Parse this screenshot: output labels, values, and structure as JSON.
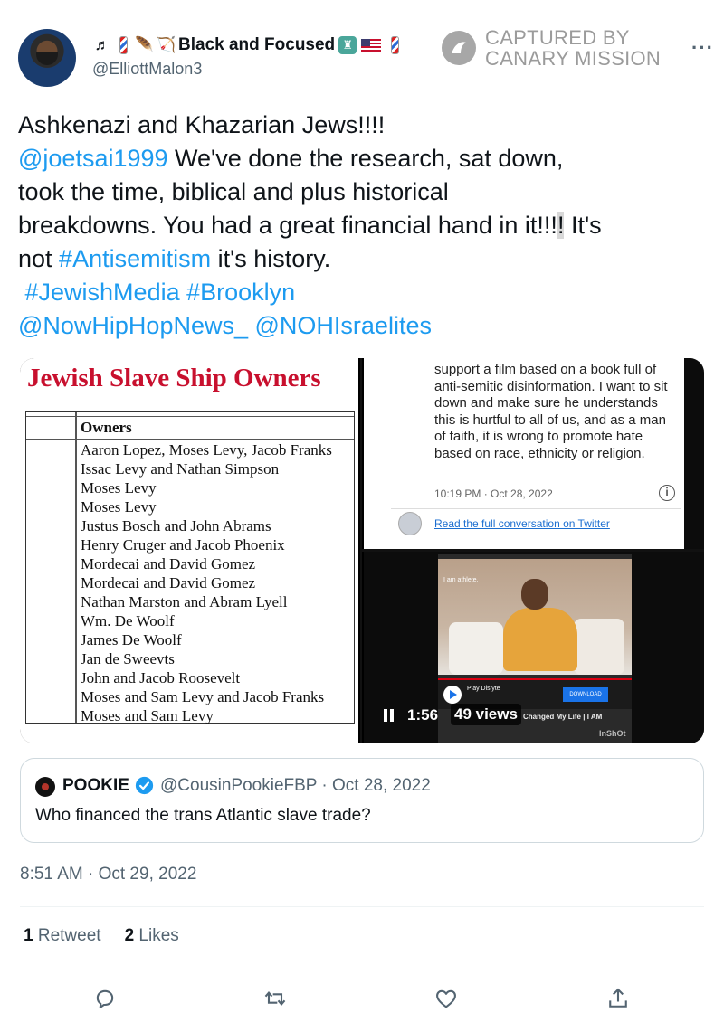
{
  "author": {
    "display_name": "Black and Focused",
    "handle": "@ElliottMalon3",
    "emoji_prefix": [
      "♬",
      "barber-pole",
      "🪶",
      "🏹"
    ],
    "emoji_suffix": [
      "statue-of-liberty",
      "us-flag",
      "barber-pole"
    ]
  },
  "watermark": {
    "line1": "CAPTURED BY",
    "line2": "CANARY MISSION"
  },
  "more_label": "···",
  "tweet": {
    "line1": "Ashkenazi and Khazarian Jews!!!!",
    "mention1": "@joetsai1999",
    "line2_rest": " We've done the research, sat down,",
    "line3": "took the time, biblical and plus historical",
    "line4_a": "breakdowns. You had a great financial hand in it!!!",
    "line4_hl": "!",
    "line4_b": " It's",
    "line5_a": "not ",
    "hashtag1": "#Antisemitism",
    "line5_b": " it's history.",
    "hashtag2": "#JewishMedia",
    "hashtag3": "#Brooklyn",
    "mention2": "@NowHipHopNews_",
    "mention3": "@NOHIsraelites"
  },
  "media": {
    "image1": {
      "title": "Jewish Slave Ship Owners",
      "column_header": "Owners",
      "owners": [
        "Aaron Lopez, Moses Levy, Jacob Franks",
        "Issac Levy and Nathan Simpson",
        "Moses Levy",
        "Moses Levy",
        "Justus Bosch and John Abrams",
        "Henry Cruger and Jacob Phoenix",
        "Mordecai and David Gomez",
        "Mordecai and David Gomez",
        "Nathan Marston and Abram Lyell",
        "Wm. De Woolf",
        "James De Woolf",
        "Jan de Sweevts",
        "John and Jacob Roosevelt",
        "Moses and Sam Levy and Jacob Franks",
        "Moses and Sam Levy"
      ]
    },
    "image2": {
      "quote": "support a film based on a book full of anti-semitic disinformation. I want to sit down and make sure he understands this is hurtful to all of us, and as a man of faith, it is wrong to promote hate based on race, ethnicity or religion.",
      "time": "10:19 PM · Oct 28, 2022",
      "read_link": "Read the full conversation on Twitter"
    },
    "video": {
      "elapsed": "1:56",
      "views": "49 views",
      "overlay_sign": "I am athlete.",
      "ad_app": "Play Dislyte",
      "ad_button": "DOWNLOAD",
      "video_title": "Changed My Life | I AM",
      "brand": "InShOt"
    }
  },
  "quoted_tweet": {
    "name": "POOKIE",
    "handle": "@CousinPookieFBP",
    "date": "Oct 28, 2022",
    "meta": "@CousinPookieFBP · Oct 28, 2022",
    "text": "Who financed the trans Atlantic slave trade?"
  },
  "timestamp": "8:51 AM · Oct 29, 2022",
  "stats": {
    "retweets_count": "1",
    "retweets_label": "Retweet",
    "likes_count": "2",
    "likes_label": "Likes"
  },
  "actions": [
    "reply-icon",
    "retweet-icon",
    "like-icon",
    "share-icon"
  ],
  "colors": {
    "link": "#1d9bf0",
    "secondary_text": "#536471",
    "title_red": "#c8102e"
  }
}
